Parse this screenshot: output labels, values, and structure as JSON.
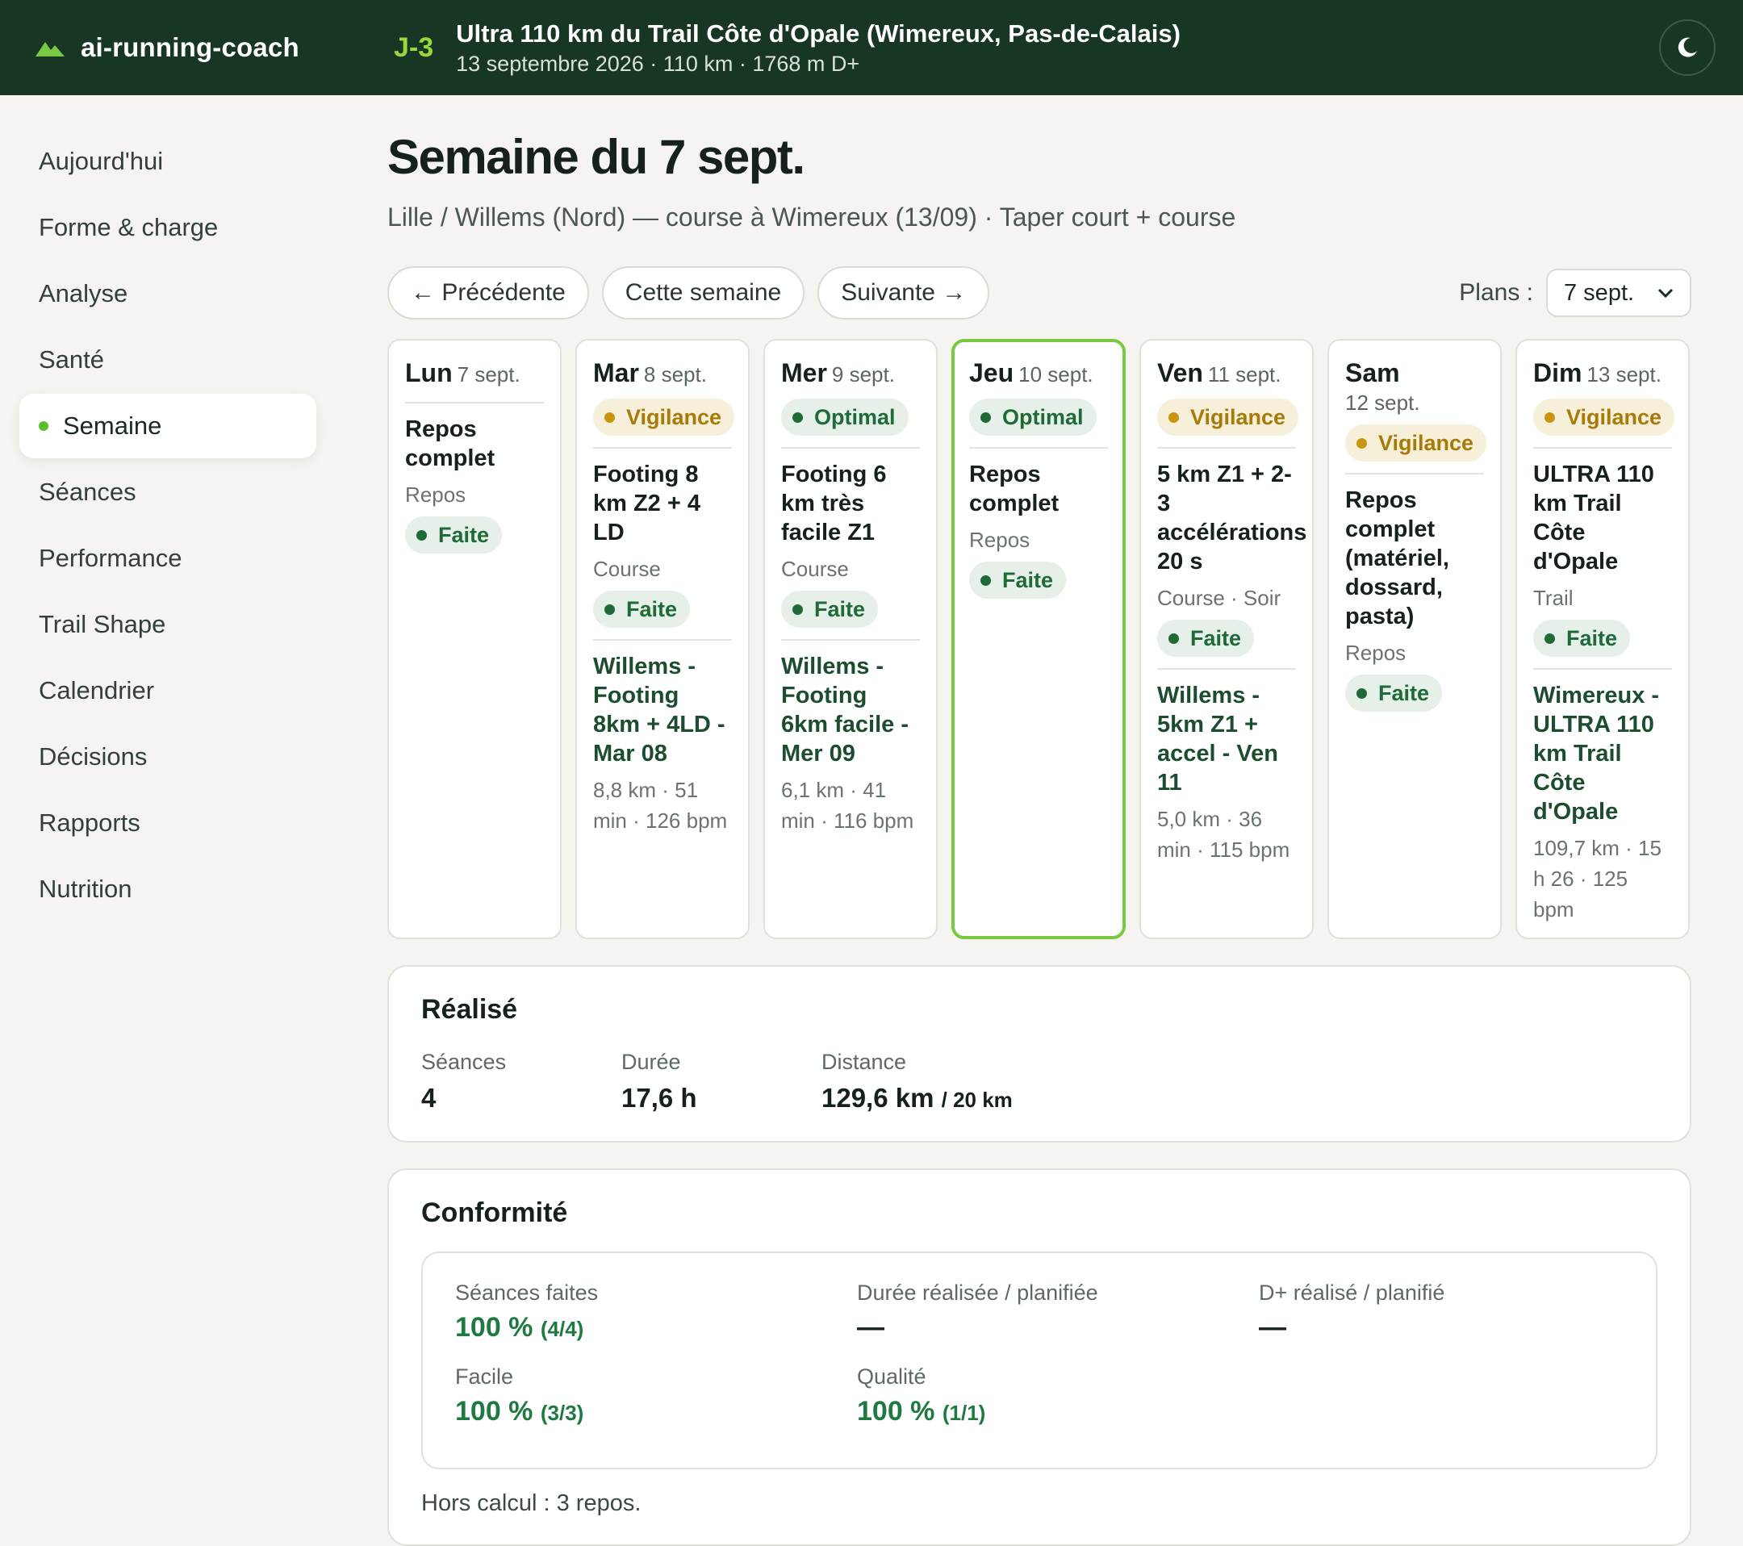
{
  "header": {
    "app_name": "ai-running-coach",
    "countdown": "J-3",
    "race_title": "Ultra 110 km du Trail Côte d'Opale (Wimereux, Pas-de-Calais)",
    "race_meta": "13 septembre 2026 · 110 km · 1768 m D+",
    "icons": {
      "logo": "mountain-icon",
      "theme": "moon-icon"
    }
  },
  "sidebar": {
    "items": [
      {
        "label": "Aujourd'hui"
      },
      {
        "label": "Forme & charge"
      },
      {
        "label": "Analyse"
      },
      {
        "label": "Santé"
      },
      {
        "label": "Semaine",
        "active": true
      },
      {
        "label": "Séances"
      },
      {
        "label": "Performance"
      },
      {
        "label": "Trail Shape"
      },
      {
        "label": "Calendrier"
      },
      {
        "label": "Décisions"
      },
      {
        "label": "Rapports"
      },
      {
        "label": "Nutrition"
      }
    ]
  },
  "page": {
    "title": "Semaine du 7 sept.",
    "subtitle": "Lille / Willems (Nord) — course à Wimereux (13/09) · Taper court + course"
  },
  "controls": {
    "prev": "← Précédente",
    "current": "Cette semaine",
    "next": "Suivante →",
    "plans_label": "Plans :",
    "plans_value": "7 sept."
  },
  "week": {
    "days": [
      {
        "name": "Lun",
        "date": "7 sept.",
        "badge": "",
        "session": "Repos complet",
        "type": "Repos",
        "status": "Faite",
        "activity": "",
        "meta": ""
      },
      {
        "name": "Mar",
        "date": "8 sept.",
        "badge": "Vigilance",
        "session": "Footing 8 km Z2 + 4 LD",
        "type": "Course",
        "status": "Faite",
        "activity": "Willems - Footing 8km + 4LD - Mar 08",
        "meta": "8,8 km · 51 min · 126 bpm"
      },
      {
        "name": "Mer",
        "date": "9 sept.",
        "badge": "Optimal",
        "session": "Footing 6 km très facile Z1",
        "type": "Course",
        "status": "Faite",
        "activity": "Willems - Footing 6km facile - Mer 09",
        "meta": "6,1 km · 41 min · 116 bpm"
      },
      {
        "name": "Jeu",
        "date": "10 sept.",
        "badge": "Optimal",
        "session": "Repos complet",
        "type": "Repos",
        "status": "Faite",
        "activity": "",
        "meta": ""
      },
      {
        "name": "Ven",
        "date": "11 sept.",
        "badge": "Vigilance",
        "session": "5 km Z1 + 2-3 accélérations 20 s",
        "type": "Course · Soir",
        "status": "Faite",
        "activity": "Willems - 5km Z1 + accel - Ven 11",
        "meta": "5,0 km · 36 min · 115 bpm"
      },
      {
        "name": "Sam",
        "date": "12 sept.",
        "badge": "Vigilance",
        "session": "Repos complet (matériel, dossard, pasta)",
        "type": "Repos",
        "status": "Faite",
        "activity": "",
        "meta": ""
      },
      {
        "name": "Dim",
        "date": "13 sept.",
        "badge": "Vigilance",
        "session": "ULTRA 110 km Trail Côte d'Opale",
        "type": "Trail",
        "status": "Faite",
        "activity": "Wimereux - ULTRA 110 km Trail Côte d'Opale",
        "meta": "109,7 km · 15 h 26 · 125 bpm"
      }
    ]
  },
  "realise": {
    "title": "Réalisé",
    "seances_label": "Séances",
    "seances_val": "4",
    "duree_label": "Durée",
    "duree_val": "17,6 h",
    "distance_label": "Distance",
    "distance_val": "129,6 km",
    "distance_target": "/ 20 km"
  },
  "conformite": {
    "title": "Conformité",
    "seances_label": "Séances faites",
    "seances_val": "100 %",
    "seances_frac": "(4/4)",
    "duree_label": "Durée réalisée / planifiée",
    "duree_val": "—",
    "dplus_label": "D+ réalisé / planifié",
    "dplus_val": "—",
    "facile_label": "Facile",
    "facile_val": "100 %",
    "facile_frac": "(3/3)",
    "qualite_label": "Qualité",
    "qualite_val": "100 %",
    "qualite_frac": "(1/1)",
    "hors_calcul": "Hors calcul : 3 repos."
  },
  "colors": {
    "header_bg": "#173624",
    "accent_green": "#7ac943",
    "vigilance": "#c9950f",
    "optimal": "#1f6b38"
  }
}
